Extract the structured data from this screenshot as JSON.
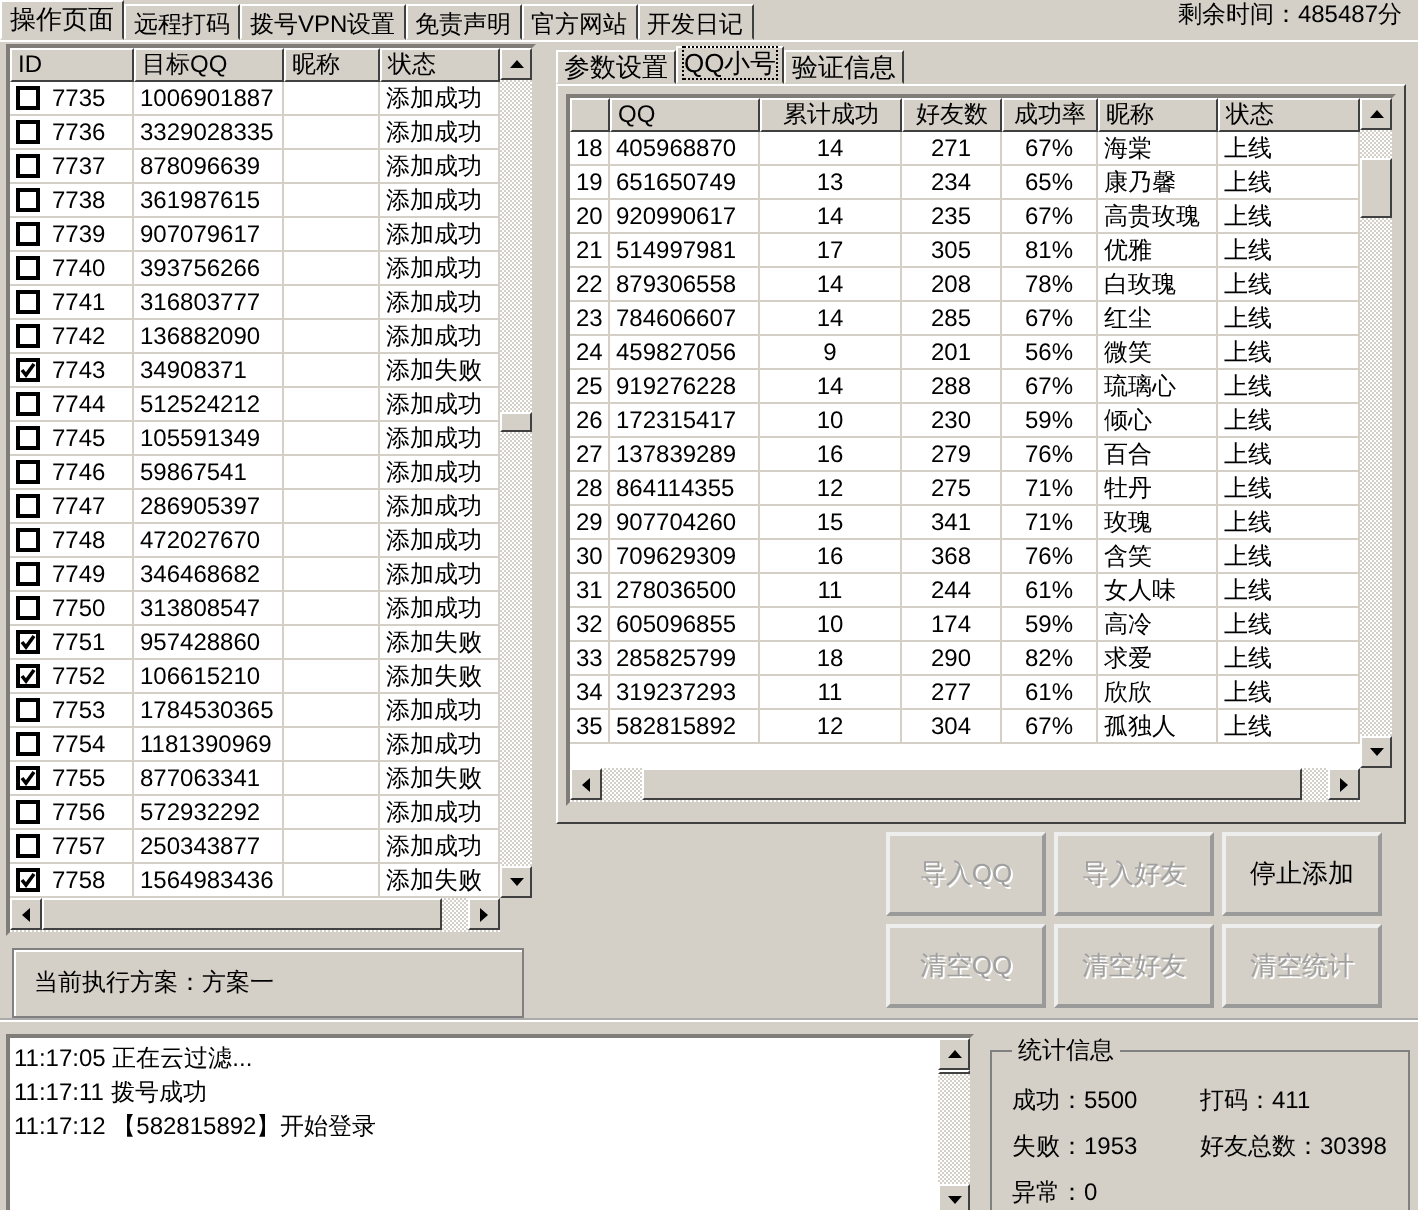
{
  "tabs": [
    {
      "label": "操作页面",
      "selected": true
    },
    {
      "label": "远程打码",
      "selected": false
    },
    {
      "label": "拨号VPN设置",
      "selected": false
    },
    {
      "label": "免责声明",
      "selected": false
    },
    {
      "label": "官方网站",
      "selected": false
    },
    {
      "label": "开发日记",
      "selected": false
    }
  ],
  "remaining_time": "剩余时间：485487分",
  "target_table": {
    "columns": [
      "ID",
      "目标QQ",
      "昵称",
      "状态"
    ],
    "rows": [
      {
        "checked": false,
        "id": "7735",
        "qq": "1006901887",
        "status": "添加成功"
      },
      {
        "checked": false,
        "id": "7736",
        "qq": "3329028335",
        "status": "添加成功"
      },
      {
        "checked": false,
        "id": "7737",
        "qq": "878096639",
        "status": "添加成功"
      },
      {
        "checked": false,
        "id": "7738",
        "qq": "361987615",
        "status": "添加成功"
      },
      {
        "checked": false,
        "id": "7739",
        "qq": "907079617",
        "status": "添加成功"
      },
      {
        "checked": false,
        "id": "7740",
        "qq": "393756266",
        "status": "添加成功"
      },
      {
        "checked": false,
        "id": "7741",
        "qq": "316803777",
        "status": "添加成功"
      },
      {
        "checked": false,
        "id": "7742",
        "qq": "136882090",
        "status": "添加成功"
      },
      {
        "checked": true,
        "id": "7743",
        "qq": "34908371",
        "status": "添加失败"
      },
      {
        "checked": false,
        "id": "7744",
        "qq": "512524212",
        "status": "添加成功"
      },
      {
        "checked": false,
        "id": "7745",
        "qq": "105591349",
        "status": "添加成功"
      },
      {
        "checked": false,
        "id": "7746",
        "qq": "59867541",
        "status": "添加成功"
      },
      {
        "checked": false,
        "id": "7747",
        "qq": "286905397",
        "status": "添加成功"
      },
      {
        "checked": false,
        "id": "7748",
        "qq": "472027670",
        "status": "添加成功"
      },
      {
        "checked": false,
        "id": "7749",
        "qq": "346468682",
        "status": "添加成功"
      },
      {
        "checked": false,
        "id": "7750",
        "qq": "313808547",
        "status": "添加成功"
      },
      {
        "checked": true,
        "id": "7751",
        "qq": "957428860",
        "status": "添加失败"
      },
      {
        "checked": true,
        "id": "7752",
        "qq": "106615210",
        "status": "添加失败"
      },
      {
        "checked": false,
        "id": "7753",
        "qq": "1784530365",
        "status": "添加成功"
      },
      {
        "checked": false,
        "id": "7754",
        "qq": "1181390969",
        "status": "添加成功"
      },
      {
        "checked": true,
        "id": "7755",
        "qq": "877063341",
        "status": "添加失败"
      },
      {
        "checked": false,
        "id": "7756",
        "qq": "572932292",
        "status": "添加成功"
      },
      {
        "checked": false,
        "id": "7757",
        "qq": "250343877",
        "status": "添加成功"
      },
      {
        "checked": true,
        "id": "7758",
        "qq": "1564983436",
        "status": "添加失败"
      }
    ]
  },
  "current_plan": "当前执行方案：方案一",
  "subtabs": [
    {
      "label": "参数设置",
      "selected": false
    },
    {
      "label": "QQ小号",
      "selected": true
    },
    {
      "label": "验证信息",
      "selected": false
    }
  ],
  "account_table": {
    "columns": [
      "",
      "QQ",
      "累计成功",
      "好友数",
      "成功率",
      "昵称",
      "状态"
    ],
    "rows": [
      [
        "18",
        "405968870",
        "14",
        "271",
        "67%",
        "海棠",
        "上线"
      ],
      [
        "19",
        "651650749",
        "13",
        "234",
        "65%",
        "康乃馨",
        "上线"
      ],
      [
        "20",
        "920990617",
        "14",
        "235",
        "67%",
        "高贵玫瑰",
        "上线"
      ],
      [
        "21",
        "514997981",
        "17",
        "305",
        "81%",
        "优雅",
        "上线"
      ],
      [
        "22",
        "879306558",
        "14",
        "208",
        "78%",
        "白玫瑰",
        "上线"
      ],
      [
        "23",
        "784606607",
        "14",
        "285",
        "67%",
        "红尘",
        "上线"
      ],
      [
        "24",
        "459827056",
        "9",
        "201",
        "56%",
        "微笑",
        "上线"
      ],
      [
        "25",
        "919276228",
        "14",
        "288",
        "67%",
        "琉璃心",
        "上线"
      ],
      [
        "26",
        "172315417",
        "10",
        "230",
        "59%",
        "倾心",
        "上线"
      ],
      [
        "27",
        "137839289",
        "16",
        "279",
        "76%",
        "百合",
        "上线"
      ],
      [
        "28",
        "864114355",
        "12",
        "275",
        "71%",
        "牡丹",
        "上线"
      ],
      [
        "29",
        "907704260",
        "15",
        "341",
        "71%",
        "玫瑰",
        "上线"
      ],
      [
        "30",
        "709629309",
        "16",
        "368",
        "76%",
        "含笑",
        "上线"
      ],
      [
        "31",
        "278036500",
        "11",
        "244",
        "61%",
        "女人味",
        "上线"
      ],
      [
        "32",
        "605096855",
        "10",
        "174",
        "59%",
        "高冷",
        "上线"
      ],
      [
        "33",
        "285825799",
        "18",
        "290",
        "82%",
        "求爱",
        "上线"
      ],
      [
        "34",
        "319237293",
        "11",
        "277",
        "61%",
        "欣欣",
        "上线"
      ],
      [
        "35",
        "582815892",
        "12",
        "304",
        "67%",
        "孤独人",
        "上线"
      ]
    ]
  },
  "buttons": [
    {
      "label": "导入QQ",
      "disabled": true
    },
    {
      "label": "导入好友",
      "disabled": true
    },
    {
      "label": "停止添加",
      "disabled": false
    },
    {
      "label": "清空QQ",
      "disabled": true
    },
    {
      "label": "清空好友",
      "disabled": true
    },
    {
      "label": "清空统计",
      "disabled": true
    }
  ],
  "log": [
    "11:17:05 正在云过滤...",
    "11:17:11 拨号成功",
    "11:17:12 【582815892】开始登录"
  ],
  "stats": {
    "title": "统计信息",
    "items": [
      "成功：5500",
      "打码：411",
      "失败：1953",
      "好友总数：30398",
      "异常：0"
    ]
  }
}
